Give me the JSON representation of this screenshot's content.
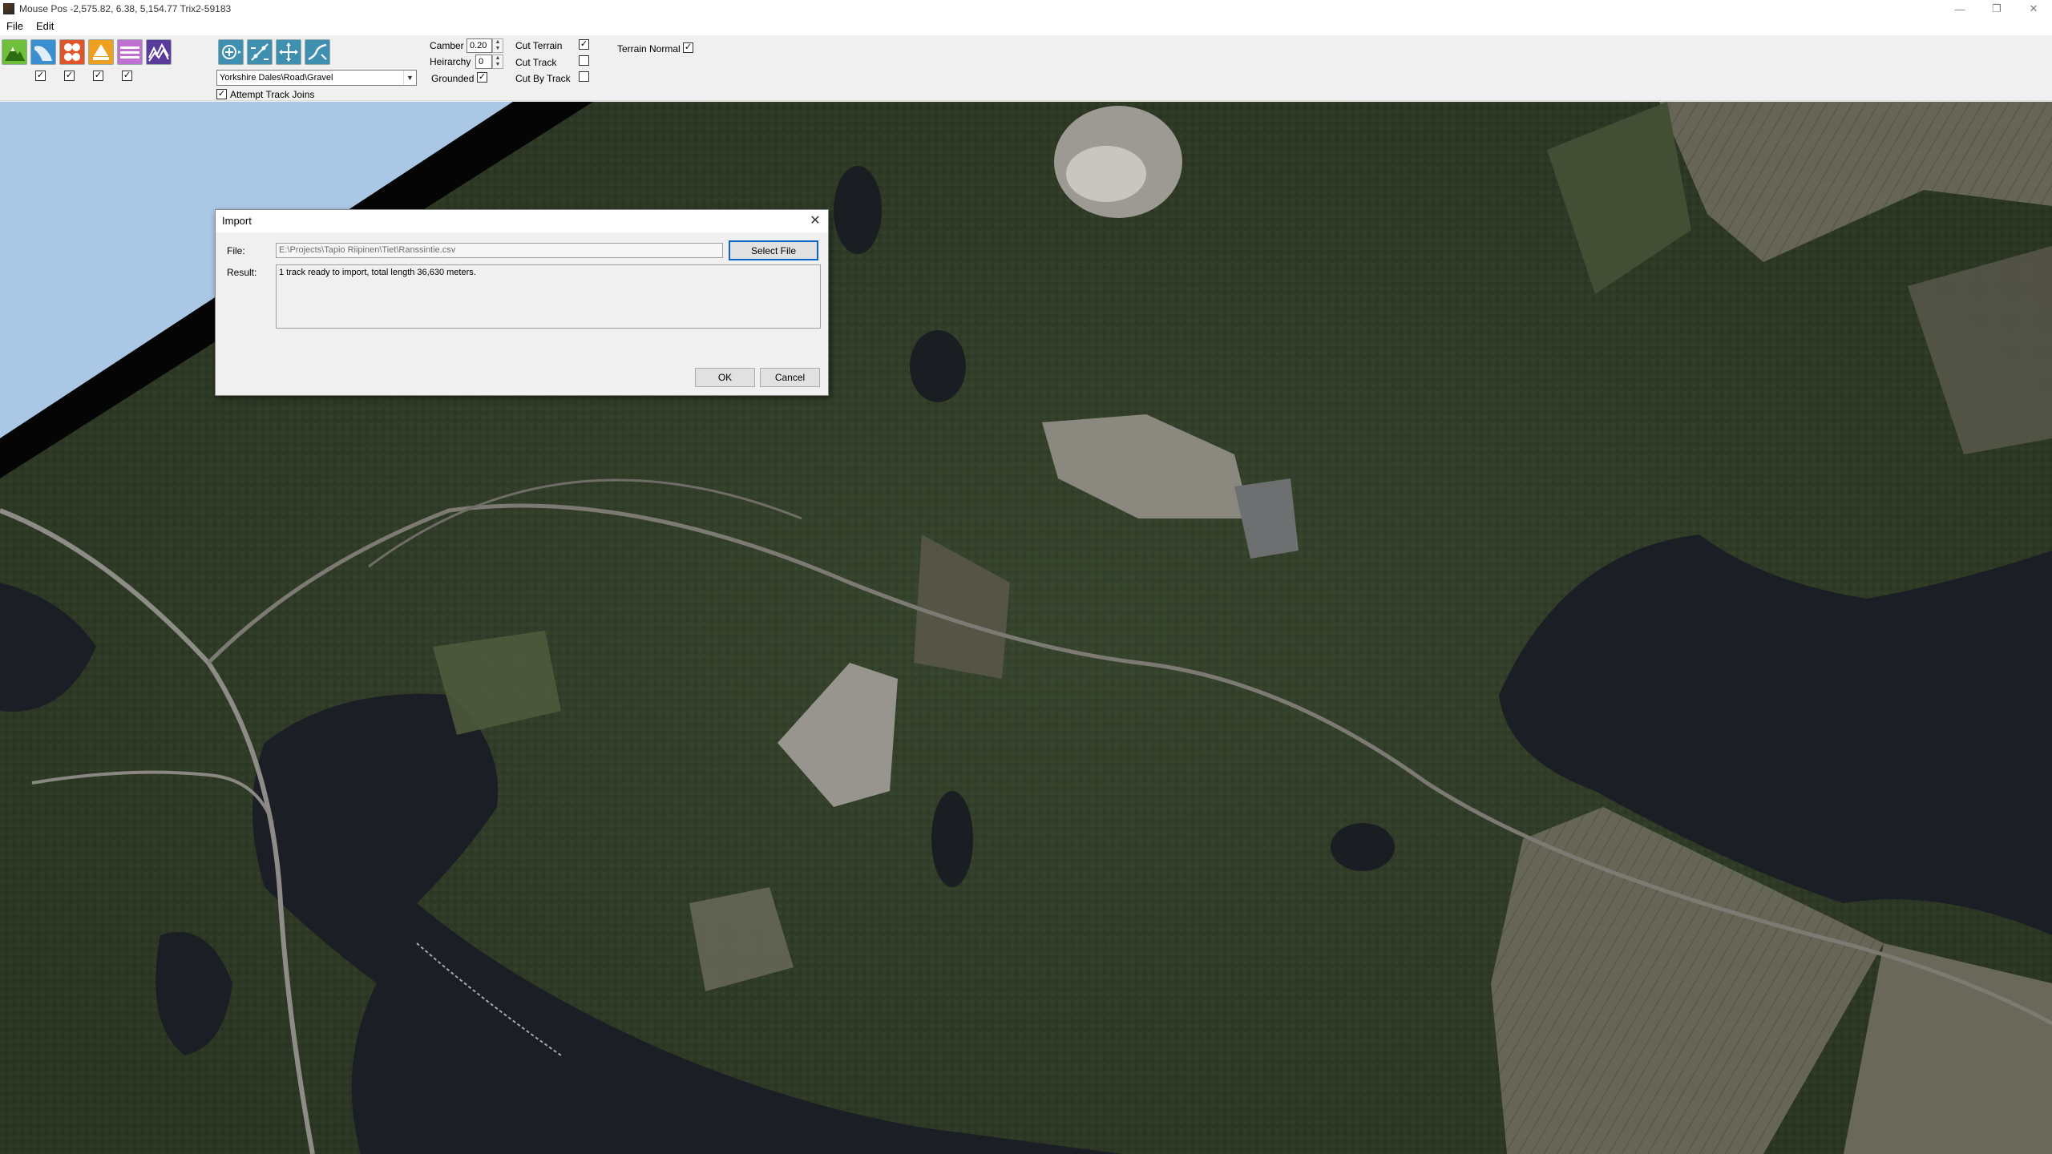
{
  "window": {
    "title": "Mouse Pos -2,575.82, 6.38, 5,154.77   Trix2-59183",
    "minimize_glyph": "—",
    "restore_glyph": "❐",
    "close_glyph": "✕"
  },
  "menu": {
    "items": [
      {
        "label": "File"
      },
      {
        "label": "Edit"
      }
    ]
  },
  "toolbar": {
    "terrain_icons": [
      {
        "name": "terrain-mountain-icon",
        "color": "#6fbf3a",
        "checked": true
      },
      {
        "name": "terrain-water-icon",
        "color": "#3a8fd0",
        "checked": true
      },
      {
        "name": "terrain-objects-icon",
        "color": "#e0542a",
        "checked": true
      },
      {
        "name": "terrain-trees-icon",
        "color": "#f0a020",
        "checked": true
      },
      {
        "name": "terrain-fence-icon",
        "color": "#c070d0",
        "checked": false
      },
      {
        "name": "terrain-texture-icon",
        "color": "#5a3a9a",
        "checked": false
      }
    ],
    "track_tools": [
      "track-add-icon",
      "track-split-icon",
      "track-move-icon",
      "track-smooth-icon"
    ],
    "track_type": "Yorkshire Dales\\Road\\Gravel",
    "attempt_track_joins": {
      "label": "Attempt Track Joins",
      "checked": true
    },
    "camber": {
      "label": "Camber",
      "value": "0.20"
    },
    "heirarchy": {
      "label": "Heirarchy",
      "value": "0"
    },
    "grounded": {
      "label": "Grounded",
      "checked": true
    },
    "cut_terrain": {
      "label": "Cut Terrain",
      "checked": true
    },
    "cut_track": {
      "label": "Cut Track",
      "checked": false
    },
    "cut_by_track": {
      "label": "Cut By Track",
      "checked": false
    },
    "terrain_normal": {
      "label": "Terrain Normal",
      "checked": true
    }
  },
  "dialog": {
    "title": "Import",
    "file_label": "File:",
    "file_value": "E:\\Projects\\Tapio Riipinen\\Tiet\\Ranssintie.csv",
    "select_file_label": "Select File",
    "result_label": "Result:",
    "result_text": "1 track ready to import, total length 36,630 meters.",
    "ok_label": "OK",
    "cancel_label": "Cancel",
    "close_glyph": "✕"
  },
  "colors": {
    "sky": "#aac8e6",
    "forest": "#2e3a27",
    "water": "#1b1e24"
  }
}
